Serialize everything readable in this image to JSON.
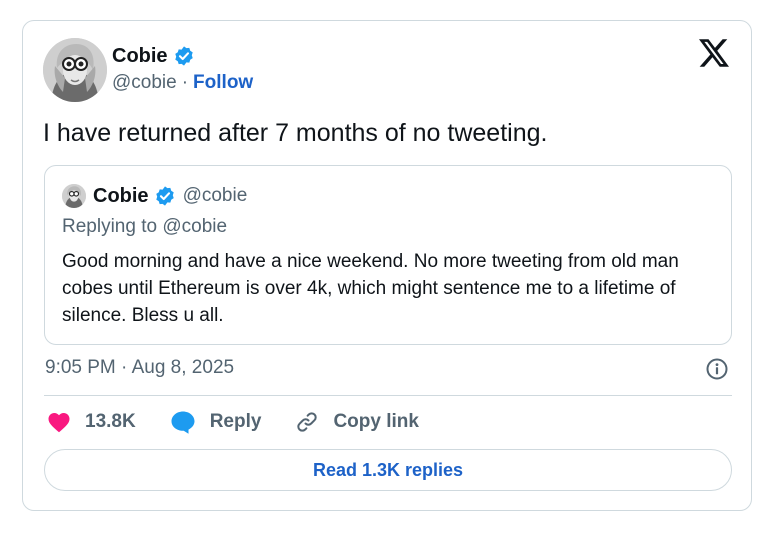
{
  "author": {
    "name": "Cobie",
    "handle": "@cobie",
    "separator": "·",
    "follow_label": "Follow"
  },
  "brand_logo": "x-logo-icon",
  "tweet": {
    "text": "I have returned after 7 months of no tweeting."
  },
  "quoted_tweet": {
    "name": "Cobie",
    "handle": "@cobie",
    "replying_to": "Replying to @cobie",
    "text": "Good morning and have a nice weekend. No more tweeting from old man cobes until Ethereum is over 4k, which might sentence me to a lifetime of silence. Bless u all."
  },
  "timestamp": "9:05 PM · Aug 8, 2025",
  "actions": {
    "likes": "13.8K",
    "reply_label": "Reply",
    "copy_link_label": "Copy link"
  },
  "read_replies_label": "Read 1.3K replies",
  "colors": {
    "accent": "#1d62c8",
    "verified": "#1d9bf0",
    "heart": "#f91880",
    "muted_text": "#536471",
    "border": "#cfd9de"
  }
}
